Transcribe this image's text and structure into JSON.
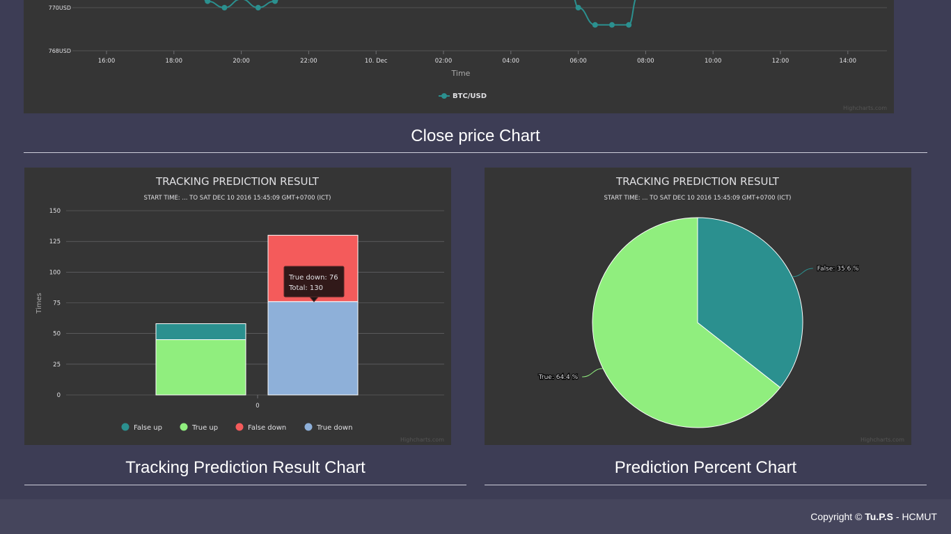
{
  "close_price": {
    "section_title": "Close price Chart",
    "watermark": "Highcharts.com",
    "chart_data": {
      "type": "line",
      "title": "",
      "xlabel": "Time",
      "ylabel": "",
      "y_tick_labels": [
        "770USD",
        "768USD"
      ],
      "x_tick_labels": [
        "16:00",
        "18:00",
        "20:00",
        "22:00",
        "10. Dec",
        "02:00",
        "04:00",
        "06:00",
        "08:00",
        "10:00",
        "12:00",
        "14:00"
      ],
      "series": [
        {
          "name": "BTC/USD",
          "color": "#2b908f",
          "points": [
            {
              "time": "19:00",
              "y": 770.3
            },
            {
              "time": "19:30",
              "y": 770.0
            },
            {
              "time": "20:00",
              "y": 770.4
            },
            {
              "time": "20:30",
              "y": 770.0
            },
            {
              "time": "21:00",
              "y": 770.3
            },
            {
              "time": "06:00",
              "y": 770.0
            },
            {
              "time": "06:30",
              "y": 769.2
            },
            {
              "time": "07:00",
              "y": 769.2
            },
            {
              "time": "07:30",
              "y": 769.2
            },
            {
              "time": "07:45",
              "y": 770.5
            }
          ]
        }
      ]
    }
  },
  "tracking": {
    "section_title": "Tracking Prediction Result Chart",
    "watermark": "Highcharts.com",
    "tooltip": {
      "line1": "True down: 76",
      "line2": "Total: 130"
    },
    "chart_data": {
      "type": "bar",
      "stacked": true,
      "title": "TRACKING PREDICTION RESULT",
      "subtitle": "START TIME: ... TO SAT DEC 10 2016 15:45:09 GMT+0700 (ICT)",
      "xlabel": "",
      "ylabel": "Times",
      "categories": [
        "0"
      ],
      "ylim": [
        0,
        150
      ],
      "yticks": [
        0,
        25,
        50,
        75,
        100,
        125,
        150
      ],
      "stacks": [
        {
          "series": [
            {
              "name": "True up",
              "color": "#90ee7e",
              "values": [
                45
              ]
            },
            {
              "name": "False up",
              "color": "#2b908f",
              "values": [
                13
              ]
            }
          ]
        },
        {
          "series": [
            {
              "name": "True down",
              "color": "#8eb0d9",
              "values": [
                76
              ]
            },
            {
              "name": "False down",
              "color": "#f45b5b",
              "values": [
                54
              ]
            }
          ]
        }
      ],
      "legend": {
        "placement": "bottom",
        "items": [
          {
            "name": "False up",
            "color": "#2b908f"
          },
          {
            "name": "True up",
            "color": "#90ee7e"
          },
          {
            "name": "False down",
            "color": "#f45b5b"
          },
          {
            "name": "True down",
            "color": "#8eb0d9"
          }
        ]
      }
    }
  },
  "percent": {
    "section_title": "Prediction Percent Chart",
    "watermark": "Highcharts.com",
    "chart_data": {
      "type": "pie",
      "title": "TRACKING PREDICTION RESULT",
      "subtitle": "START TIME: ... TO SAT DEC 10 2016 15:45:09 GMT+0700 (ICT)",
      "slices": [
        {
          "name": "False",
          "value": 35.6,
          "label": "False: 35.6 %",
          "color": "#2b908f"
        },
        {
          "name": "True",
          "value": 64.4,
          "label": "True: 64.4 %",
          "color": "#90ee7e"
        }
      ]
    }
  },
  "footer": {
    "prefix": "Copyright ©",
    "brand": "Tu.P.S",
    "suffix": "- HCMUT"
  }
}
